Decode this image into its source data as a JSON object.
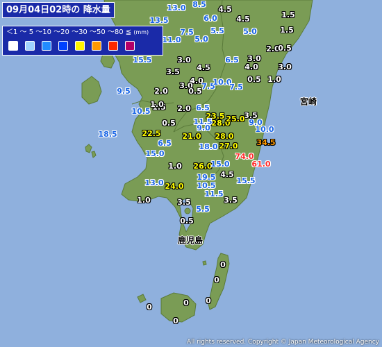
{
  "title": "09月04日02時の 降水量",
  "legend": {
    "scale_text": "＜1 ～ 5 ～10 ～20 ～30 ～50 ～80 ≦",
    "unit": "(mm)",
    "swatch_colors": [
      "#ffffff",
      "#a0d2ff",
      "#218cff",
      "#0041ff",
      "#fff500",
      "#ff9900",
      "#ff2800",
      "#b40068"
    ]
  },
  "places": [
    {
      "name": "宮崎"
    },
    {
      "name": "鹿児島"
    }
  ],
  "stations": [
    {
      "value": "8.5",
      "level": 2
    },
    {
      "value": "13.0",
      "level": 2
    },
    {
      "value": "4.5",
      "level": 1
    },
    {
      "value": "1.5",
      "level": 0
    },
    {
      "value": "13.5",
      "level": 2
    },
    {
      "value": "6.0",
      "level": 2
    },
    {
      "value": "4.5",
      "level": 1
    },
    {
      "value": "7.5",
      "level": 2
    },
    {
      "value": "5.5",
      "level": 2
    },
    {
      "value": "5.0",
      "level": 2
    },
    {
      "value": "5.0",
      "level": 2
    },
    {
      "value": "1.5",
      "level": 0
    },
    {
      "value": "11.0",
      "level": 2
    },
    {
      "value": "2.0",
      "level": 0
    },
    {
      "value": "0.5",
      "level": 0
    },
    {
      "value": "3.0",
      "level": 0
    },
    {
      "value": "6.5",
      "level": 2
    },
    {
      "value": "3.0",
      "level": 0
    },
    {
      "value": "15.5",
      "level": 2
    },
    {
      "value": "3.5",
      "level": 0
    },
    {
      "value": "4.5",
      "level": 0
    },
    {
      "value": "4.0",
      "level": 0
    },
    {
      "value": "3.0",
      "level": 0
    },
    {
      "value": "0.5",
      "level": 0
    },
    {
      "value": "9.5",
      "level": 2
    },
    {
      "value": "2.0",
      "level": 0
    },
    {
      "value": "3.0",
      "level": 0
    },
    {
      "value": "4.0",
      "level": 0
    },
    {
      "value": "7.5",
      "level": 2
    },
    {
      "value": "10.0",
      "level": 2
    },
    {
      "value": "7.5",
      "level": 2
    },
    {
      "value": "0.5",
      "level": 0
    },
    {
      "value": "1.0",
      "level": 0
    },
    {
      "value": "10.5",
      "level": 2
    },
    {
      "value": "2.0",
      "level": 0
    },
    {
      "value": "6.5",
      "level": 2
    },
    {
      "value": "1.5",
      "level": 0
    },
    {
      "value": "1.0",
      "level": 0
    },
    {
      "value": "0.5",
      "level": 0
    },
    {
      "value": "23.5",
      "level": 4
    },
    {
      "value": "3.5",
      "level": 0
    },
    {
      "value": "28.0",
      "level": 4
    },
    {
      "value": "25.0",
      "level": 4
    },
    {
      "value": "11.5",
      "level": 2
    },
    {
      "value": "9.0",
      "level": 2
    },
    {
      "value": "9.0",
      "level": 2
    },
    {
      "value": "18.5",
      "level": 2
    },
    {
      "value": "22.5",
      "level": 4
    },
    {
      "value": "10.0",
      "level": 2
    },
    {
      "value": "21.0",
      "level": 4
    },
    {
      "value": "28.0",
      "level": 4
    },
    {
      "value": "6.5",
      "level": 2
    },
    {
      "value": "18.0",
      "level": 2
    },
    {
      "value": "27.0",
      "level": 4
    },
    {
      "value": "34.5",
      "level": 5
    },
    {
      "value": "15.0",
      "level": 2
    },
    {
      "value": "74.0",
      "level": 6
    },
    {
      "value": "1.0",
      "level": 0
    },
    {
      "value": "26.0",
      "level": 4
    },
    {
      "value": "15.0",
      "level": 2
    },
    {
      "value": "61.0",
      "level": 6
    },
    {
      "value": "4.5",
      "level": 1
    },
    {
      "value": "19.5",
      "level": 2
    },
    {
      "value": "15.5",
      "level": 2
    },
    {
      "value": "13.0",
      "level": 2
    },
    {
      "value": "10.5",
      "level": 2
    },
    {
      "value": "24.0",
      "level": 4
    },
    {
      "value": "11.5",
      "level": 2
    },
    {
      "value": "1.0",
      "level": 0
    },
    {
      "value": "3.5",
      "level": 0
    },
    {
      "value": "3.5",
      "level": 0
    },
    {
      "value": "5.5",
      "level": 2
    },
    {
      "value": "0.5",
      "level": 0
    },
    {
      "value": "0",
      "level": 0
    },
    {
      "value": "0",
      "level": 0
    },
    {
      "value": "0",
      "level": 0
    },
    {
      "value": "0",
      "level": 0
    },
    {
      "value": "0",
      "level": 0
    },
    {
      "value": "0",
      "level": 0
    }
  ],
  "copyright": "All rights reserved. Copyright © Japan Meteorological Agency"
}
